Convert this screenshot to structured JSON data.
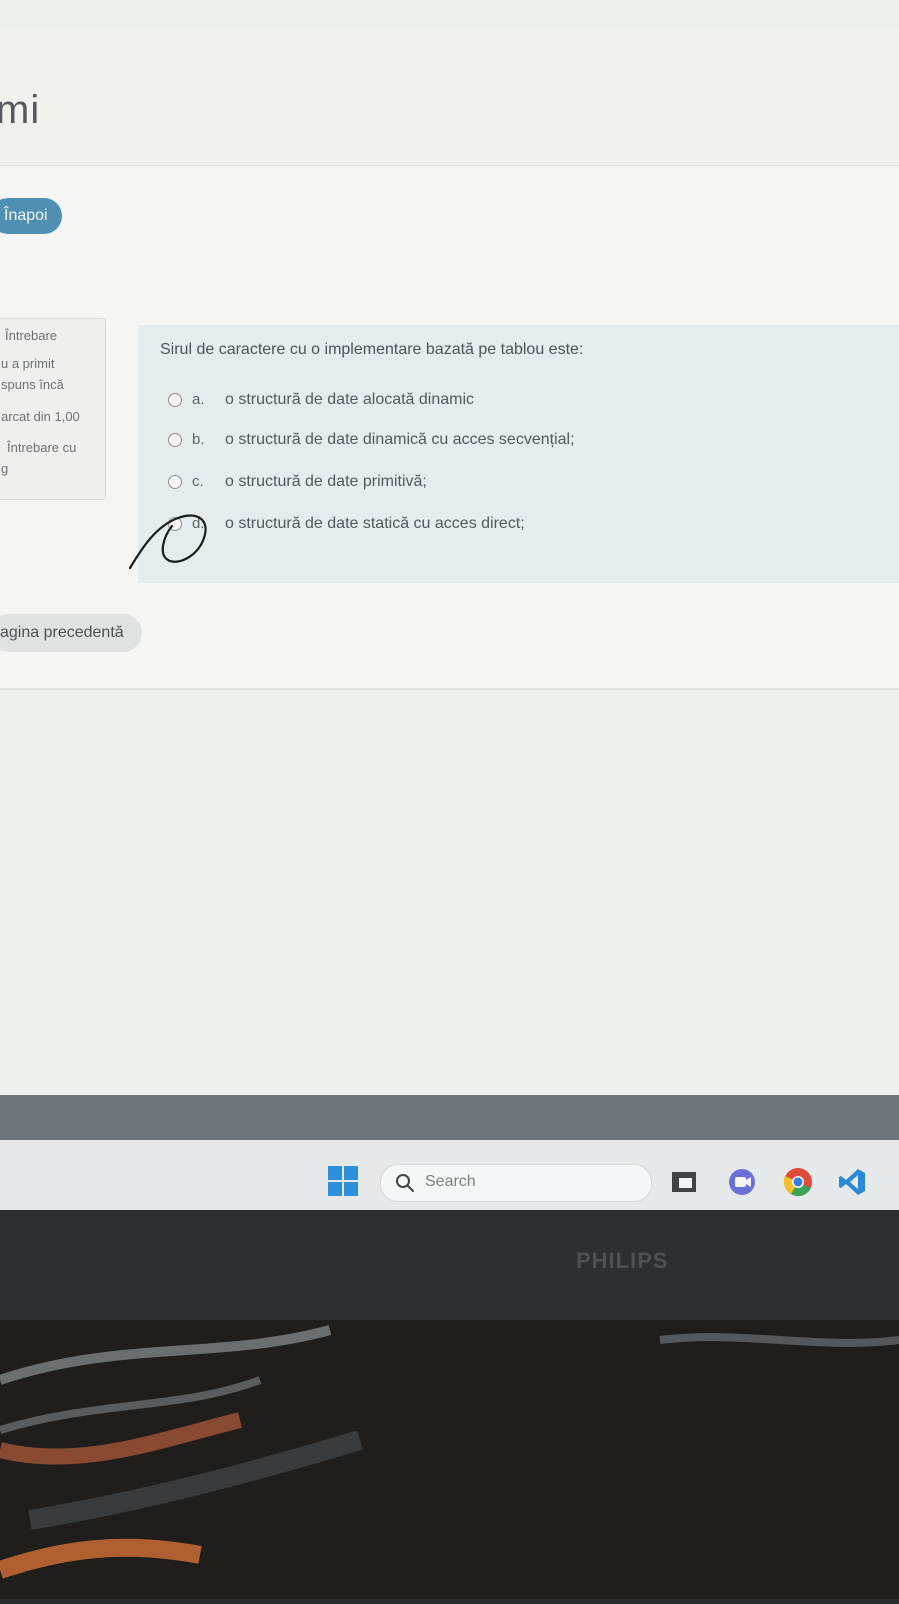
{
  "page": {
    "title_fragment": "mi",
    "back_label": "Înapoi"
  },
  "question_info": {
    "lines": [
      "Întrebare",
      "u a primit",
      "spuns încă",
      "arcat din 1,00",
      "Întrebare cu",
      "g"
    ]
  },
  "question": {
    "prompt": "Sirul de caractere cu o implementare bazată pe tablou este:",
    "answers": [
      {
        "letter": "a.",
        "text": "o structură de date alocată dinamic",
        "selected": false
      },
      {
        "letter": "b.",
        "text": "o structură de date dinamică cu acces secvențial;",
        "selected": false
      },
      {
        "letter": "c.",
        "text": "o structură de date primitivă;",
        "selected": false
      },
      {
        "letter": "d.",
        "text": "o structură de date statică cu acces direct;",
        "selected": false
      }
    ]
  },
  "navigation": {
    "previous_label": "agina precedentă"
  },
  "taskbar": {
    "search_placeholder": "Search",
    "icons": [
      "windows-start-icon",
      "search-icon",
      "file-explorer-icon",
      "video-call-icon",
      "chrome-icon",
      "vscode-icon"
    ]
  },
  "monitor": {
    "brand": "PHILIPS"
  },
  "colors": {
    "accent": "#4e8fb2",
    "question_bg": "#e4ecee"
  }
}
